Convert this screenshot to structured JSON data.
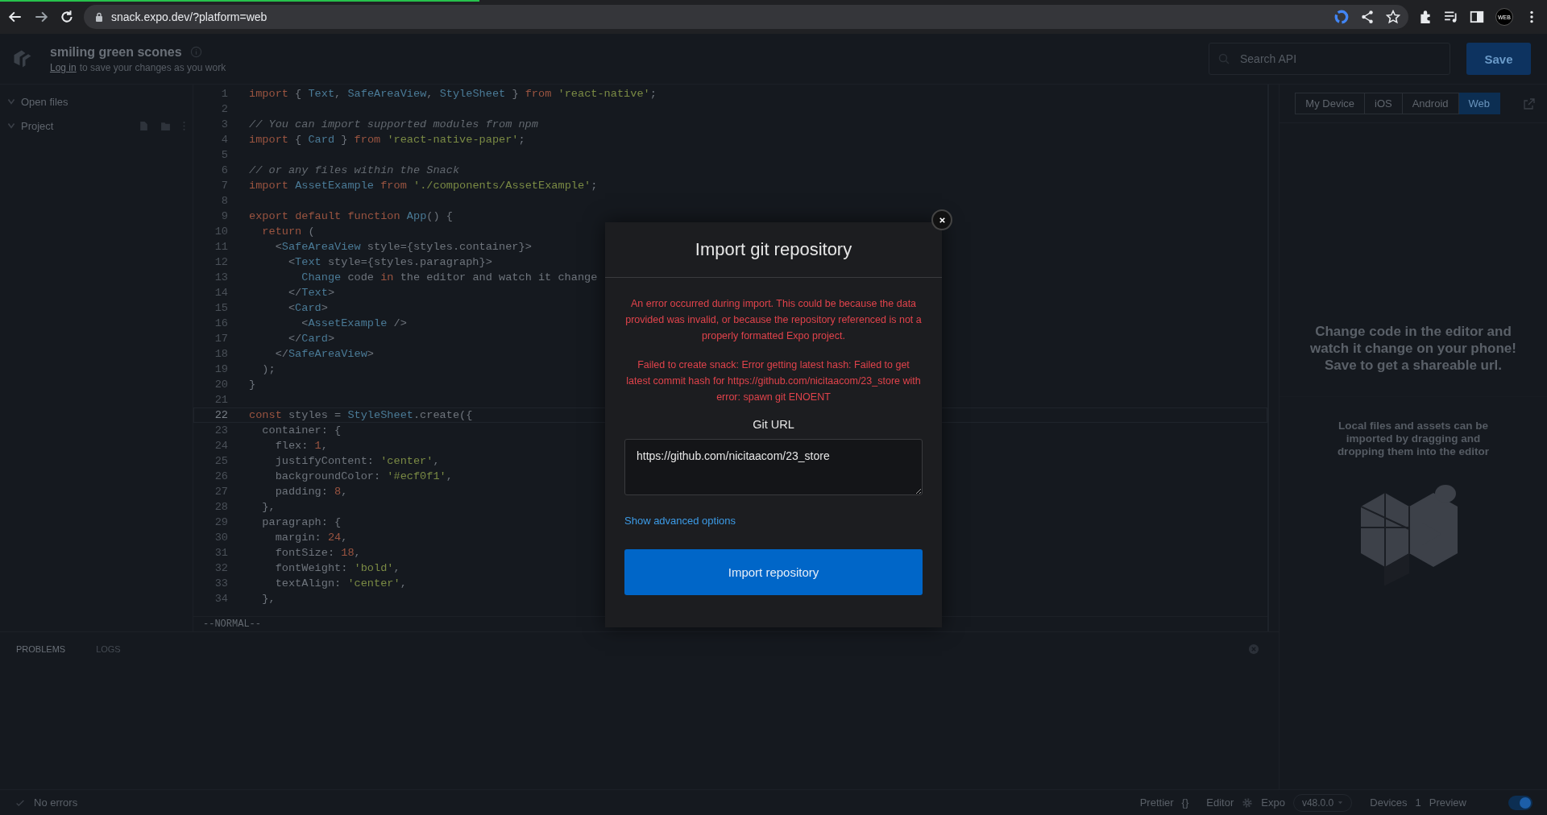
{
  "browser": {
    "url": "snack.expo.dev/?platform=web",
    "profile_label": "WEB",
    "load_progress": {
      "level": 0.31
    }
  },
  "header": {
    "title": "smiling green scones",
    "login_link": "Log in",
    "login_rest": "to save your changes as you work",
    "search_placeholder": "Search API",
    "save_label": "Save"
  },
  "sidebar": {
    "sections": [
      {
        "label": "Open files",
        "expanded": true
      },
      {
        "label": "Project",
        "expanded": true
      }
    ]
  },
  "editor": {
    "lines": [
      {
        "number": "1",
        "current": false,
        "text": "import { Text, SafeAreaView, StyleSheet } from 'react-native';"
      },
      {
        "number": "2",
        "current": false
      },
      {
        "number": "3",
        "current": false,
        "text": "// You can import supported modules from npm"
      },
      {
        "number": "4",
        "current": false,
        "text": "import { Card } from 'react-native-paper';"
      },
      {
        "number": "5",
        "current": false
      },
      {
        "number": "6",
        "current": false,
        "text": "// or any files within the Snack"
      },
      {
        "number": "7",
        "current": false,
        "text": "import AssetExample from './components/AssetExample';"
      },
      {
        "number": "8",
        "current": false
      },
      {
        "number": "9",
        "current": false,
        "text": "export default function App() {"
      },
      {
        "number": "10",
        "current": false,
        "text": "  return ("
      },
      {
        "number": "11",
        "current": false,
        "text": "    <SafeAreaView style={styles.container}>"
      },
      {
        "number": "12",
        "current": false,
        "text": "      <Text style={styles.paragraph}>"
      },
      {
        "number": "13",
        "current": false,
        "text": "        Change code in the editor and watch it change"
      },
      {
        "number": "14",
        "current": false,
        "text": "      </Text>"
      },
      {
        "number": "15",
        "current": false,
        "text": "      <Card>"
      },
      {
        "number": "16",
        "current": false,
        "text": "        <AssetExample />"
      },
      {
        "number": "17",
        "current": false,
        "text": "      </Card>"
      },
      {
        "number": "18",
        "current": false,
        "text": "    </SafeAreaView>"
      },
      {
        "number": "19",
        "current": false,
        "text": "  );"
      },
      {
        "number": "20",
        "current": false,
        "text": "}"
      },
      {
        "number": "21",
        "current": false
      },
      {
        "number": "22",
        "current": true,
        "text": "const styles = StyleSheet.create({"
      },
      {
        "number": "23",
        "current": false,
        "text": "  container: {"
      },
      {
        "number": "24",
        "current": false,
        "text": "    flex: 1,"
      },
      {
        "number": "25",
        "current": false,
        "text": "    justifyContent: 'center',"
      },
      {
        "number": "26",
        "current": false,
        "text": "    backgroundColor: '#ecf0f1',"
      },
      {
        "number": "27",
        "current": false,
        "text": "    padding: 8,"
      },
      {
        "number": "28",
        "current": false,
        "text": "  },"
      },
      {
        "number": "29",
        "current": false,
        "text": "  paragraph: {"
      },
      {
        "number": "30",
        "current": false,
        "text": "    margin: 24,"
      },
      {
        "number": "31",
        "current": false,
        "text": "    fontSize: 18,"
      },
      {
        "number": "32",
        "current": false,
        "text": "    fontWeight: 'bold',"
      },
      {
        "number": "33",
        "current": false,
        "text": "    textAlign: 'center',"
      },
      {
        "number": "34",
        "current": false,
        "text": "  },"
      }
    ],
    "mode": "--NORMAL--"
  },
  "bottom_panel": {
    "tabs": [
      {
        "label": "PROBLEMS",
        "selected": true
      },
      {
        "label": "LOGS",
        "selected": false
      }
    ]
  },
  "preview": {
    "devices": [
      {
        "label": "My Device",
        "selected": false
      },
      {
        "label": "iOS",
        "selected": false
      },
      {
        "label": "Android",
        "selected": false
      },
      {
        "label": "Web",
        "selected": true
      }
    ],
    "message": "Change code in the editor and watch it change on your phone! Save to get a shareable url.",
    "hint": "Local files and assets can be imported by dragging and dropping them into the editor"
  },
  "status_bar": {
    "problems": "No errors",
    "prettier": "Prettier",
    "prettier_symbol": "{}",
    "editor": "Editor",
    "expo": "Expo",
    "version": "v48.0.0",
    "devices": "Devices",
    "device_count": "1",
    "preview": "Preview",
    "preview_on": true
  },
  "modal": {
    "title": "Import git repository",
    "errors": [
      "An error occurred during import. This could be because the data provided was invalid, or because the repository referenced is not a properly formatted Expo project.",
      "Failed to create snack: Error getting latest hash: Failed to get latest commit hash for https://github.com/nicitaacom/23_store with error: spawn git ENOENT"
    ],
    "field_label": "Git URL",
    "url": "https://github.com/nicitaacom/23_store",
    "advanced_link": "Show advanced options",
    "button": "Import repository"
  }
}
